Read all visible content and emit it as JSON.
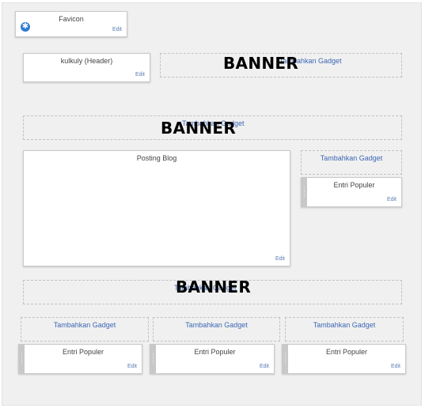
{
  "favicon": {
    "title": "Favicon",
    "edit": "Edit"
  },
  "header": {
    "title": "kulkuly (Header)",
    "edit": "Edit"
  },
  "add_gadget_label": "Tambahkan Gadget",
  "banner_text": "BANNER",
  "posting": {
    "title": "Posting Blog",
    "edit": "Edit"
  },
  "popular_title": "Entri Populer",
  "edit_label": "Edit",
  "colors": {
    "link": "#3d67b5",
    "edit": "#5b7bb5",
    "favicon": "#2f7bd2"
  }
}
